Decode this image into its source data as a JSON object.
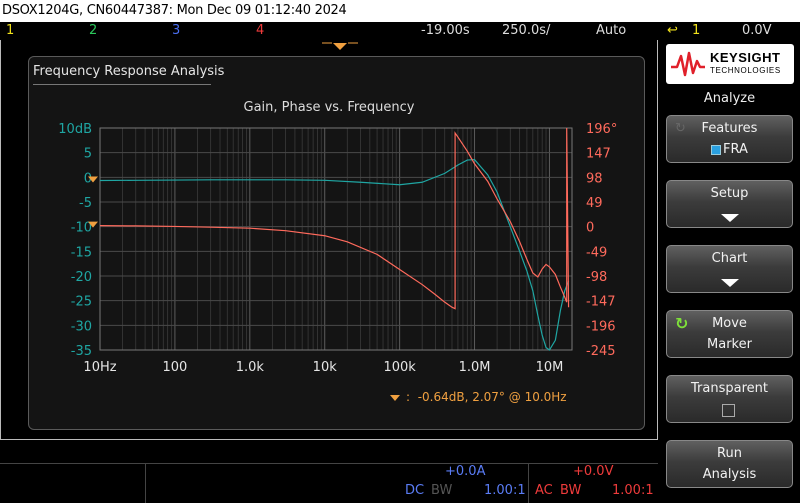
{
  "title_bar": "DSOX1204G, CN60447387: Mon Dec 09 01:12:40 2024",
  "status_bar": {
    "ch1": "1",
    "ch2": "2",
    "ch3": "3",
    "ch4": "4",
    "time_ref": "-19.00s",
    "time_ref_unit_note": "",
    "timebase": "250.0s/",
    "trigger_mode": "Auto",
    "trigger_channel": "1",
    "trigger_level": "0.0V"
  },
  "colors": {
    "ch1": "#f2e21b",
    "ch2": "#2bc85b",
    "ch3": "#4a6ef0",
    "ch4": "#ee3b3b",
    "gain_trace": "#1fa6a3",
    "phase_trace": "#ff6a5c",
    "marker": "#f0a040"
  },
  "fra": {
    "panel_title": "Frequency Response Analysis",
    "chart_title": "Gain, Phase vs. Frequency",
    "marker_readout": "-0.64dB, 2.07° @ 10.0Hz",
    "marker_prefix": ":"
  },
  "chart_data": {
    "type": "line",
    "title": "Gain, Phase vs. Frequency",
    "x_scale": "log",
    "x_ticks": [
      "10Hz",
      "100",
      "1.0k",
      "10k",
      "100k",
      "1.0M",
      "10M"
    ],
    "x_tick_values": [
      10,
      100,
      1000,
      10000,
      100000,
      1000000,
      10000000
    ],
    "xlim": [
      10,
      20000000
    ],
    "y_left_ticks": [
      "10dB",
      "5",
      "0",
      "-5",
      "-10",
      "-15",
      "-20",
      "-25",
      "-30",
      "-35"
    ],
    "y_left_values": [
      10,
      5,
      0,
      -5,
      -10,
      -15,
      -20,
      -25,
      -30,
      -35
    ],
    "ylim_left": [
      -35,
      10
    ],
    "y_right_ticks": [
      "196°",
      "147",
      "98",
      "49",
      "0",
      "-49",
      "-98",
      "-147",
      "-196",
      "-245"
    ],
    "y_right_values": [
      196,
      147,
      98,
      49,
      0,
      -49,
      -98,
      -147,
      -196,
      -245
    ],
    "ylim_right": [
      -245,
      196
    ],
    "grid": true,
    "series": [
      {
        "axis": "left",
        "x": [
          10,
          30,
          100,
          300,
          1000,
          3000,
          10000,
          30000,
          100000,
          200000,
          400000,
          600000,
          800000,
          1000000,
          1500000,
          2000000,
          3000000,
          4000000,
          5000000,
          6000000,
          7000000,
          8000000,
          9000000,
          10000000,
          12000000,
          14000000,
          16000000,
          18000000
        ],
        "y": [
          -0.64,
          -0.6,
          -0.55,
          -0.5,
          -0.5,
          -0.5,
          -0.6,
          -1.0,
          -1.5,
          -1.0,
          0.8,
          2.5,
          3.5,
          3.6,
          0.5,
          -3.0,
          -10.0,
          -15.0,
          -19.0,
          -23.0,
          -28.0,
          -32.0,
          -34.5,
          -35.0,
          -33.0,
          -27.0,
          -23.0,
          -21.0
        ]
      },
      {
        "axis": "right",
        "x": [
          10,
          30,
          100,
          300,
          1000,
          3000,
          10000,
          20000,
          50000,
          100000,
          200000,
          300000,
          400000,
          500000,
          550000,
          550001,
          600000,
          800000,
          1000000,
          1500000,
          2000000,
          3000000,
          4000000,
          5000000,
          6000000,
          7000000,
          8000000,
          9000000,
          10000000,
          12000000,
          14000000,
          16000000,
          17000000,
          17000001,
          18000000
        ],
        "y": [
          2.07,
          1.5,
          0.5,
          -1,
          -3,
          -8,
          -18,
          -30,
          -55,
          -85,
          -115,
          -135,
          -150,
          -160,
          -163,
          186,
          178,
          150,
          125,
          90,
          55,
          10,
          -30,
          -65,
          -92,
          -100,
          -84,
          -75,
          -80,
          -95,
          -120,
          -140,
          -150,
          196,
          -160
        ]
      }
    ],
    "marker": {
      "x": 10,
      "gain_db": -0.64,
      "phase_deg": 2.07
    }
  },
  "bottom_bar": {
    "left_offset": "+0.0A",
    "left_coupling": "DC",
    "left_bw": "BW",
    "left_probe": "1.00:1",
    "right_offset": "+0.0V",
    "right_coupling": "AC",
    "right_bw": "BW",
    "right_probe": "1.00:1"
  },
  "sidebar": {
    "logo_line1": "KEYSIGHT",
    "logo_line2": "TECHNOLOGIES",
    "menu_title": "Analyze",
    "softkeys": [
      {
        "line1": "Features",
        "line2": "FRA"
      },
      {
        "line1": "Setup"
      },
      {
        "line1": "Chart"
      },
      {
        "line1": "Move",
        "line2": "Marker"
      },
      {
        "line1": "Transparent"
      },
      {
        "line1": "Run",
        "line2": "Analysis"
      }
    ]
  }
}
